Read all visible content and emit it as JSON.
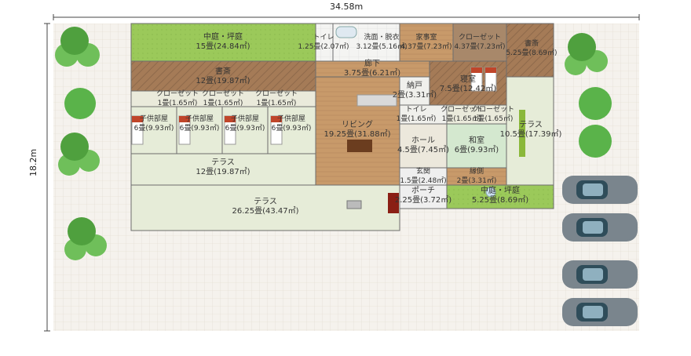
{
  "dimensions": {
    "width_label": "34.58m",
    "height_label": "18.2m"
  },
  "rooms": [
    {
      "key": "nakaniwa1",
      "name": "中庭・坪庭",
      "area": "15畳(24.84㎡)"
    },
    {
      "key": "toilet1",
      "name": "トイレ",
      "area": "1.25畳(2.07㎡)"
    },
    {
      "key": "senmen",
      "name": "洗面・脱衣",
      "area": "3.12畳(5.16㎡)"
    },
    {
      "key": "kaji",
      "name": "家事室",
      "area": "4.37畳(7.23㎡)"
    },
    {
      "key": "closet1",
      "name": "クローゼット",
      "area": "4.37畳(7.23㎡)"
    },
    {
      "key": "shosai1",
      "name": "書斎",
      "area": "5.25畳(8.69㎡)"
    },
    {
      "key": "shosai2",
      "name": "書斎",
      "area": "12畳(19.87㎡)"
    },
    {
      "key": "rouka",
      "name": "廊下",
      "area": "3.75畳(6.21㎡)"
    },
    {
      "key": "nando",
      "name": "納戸",
      "area": "2畳(3.31㎡)"
    },
    {
      "key": "shinshitsu",
      "name": "寝室",
      "area": "7.5畳(12.42㎡)"
    },
    {
      "key": "closet_a",
      "name": "クローゼット",
      "area": "1畳(1.65㎡)"
    },
    {
      "key": "closet_b",
      "name": "クローゼット",
      "area": "1畳(1.65㎡)"
    },
    {
      "key": "closet_c",
      "name": "クローゼット",
      "area": "1畳(1.65㎡)"
    },
    {
      "key": "kodomo_a",
      "name": "子供部屋",
      "area": "6畳(9.93㎡)"
    },
    {
      "key": "kodomo_b",
      "name": "子供部屋",
      "area": "6畳(9.93㎡)"
    },
    {
      "key": "kodomo_c",
      "name": "子供部屋",
      "area": "6畳(9.93㎡)"
    },
    {
      "key": "kodomo_d",
      "name": "子供部屋",
      "area": "6畳(9.93㎡)"
    },
    {
      "key": "living",
      "name": "リビング",
      "area": "19.25畳(31.88㎡)"
    },
    {
      "key": "toilet2",
      "name": "トイレ",
      "area": "1畳(1.65㎡)"
    },
    {
      "key": "closet_d",
      "name": "クローゼット",
      "area": "1畳(1.65㎡)"
    },
    {
      "key": "closet_e",
      "name": "クローゼット",
      "area": "1畳(1.65㎡)"
    },
    {
      "key": "terrace_r",
      "name": "テラス",
      "area": "10.5畳(17.39㎡)"
    },
    {
      "key": "hall",
      "name": "ホール",
      "area": "4.5畳(7.45㎡)"
    },
    {
      "key": "washitsu",
      "name": "和室",
      "area": "6畳(9.93㎡)"
    },
    {
      "key": "terrace_m",
      "name": "テラス",
      "area": "12畳(19.87㎡)"
    },
    {
      "key": "genkan",
      "name": "玄関",
      "area": "1.5畳(2.48㎡)"
    },
    {
      "key": "engawa",
      "name": "縁側",
      "area": "2畳(3.31㎡)"
    },
    {
      "key": "terrace_b",
      "name": "テラス",
      "area": "26.25畳(43.47㎡)"
    },
    {
      "key": "porch",
      "name": "ポーチ",
      "area": "2.25畳(3.72㎡)"
    },
    {
      "key": "nakaniwa2",
      "name": "中庭・坪庭",
      "area": "5.25畳(8.69㎡)"
    }
  ],
  "colors": {
    "lawn": "#9bc95a",
    "floor_wood": "#c89a6a",
    "floor_light": "#e6ecd8",
    "tile": "#f2f2f2",
    "grid_bg": "#efeae1",
    "wall": "#6d6d6d"
  }
}
